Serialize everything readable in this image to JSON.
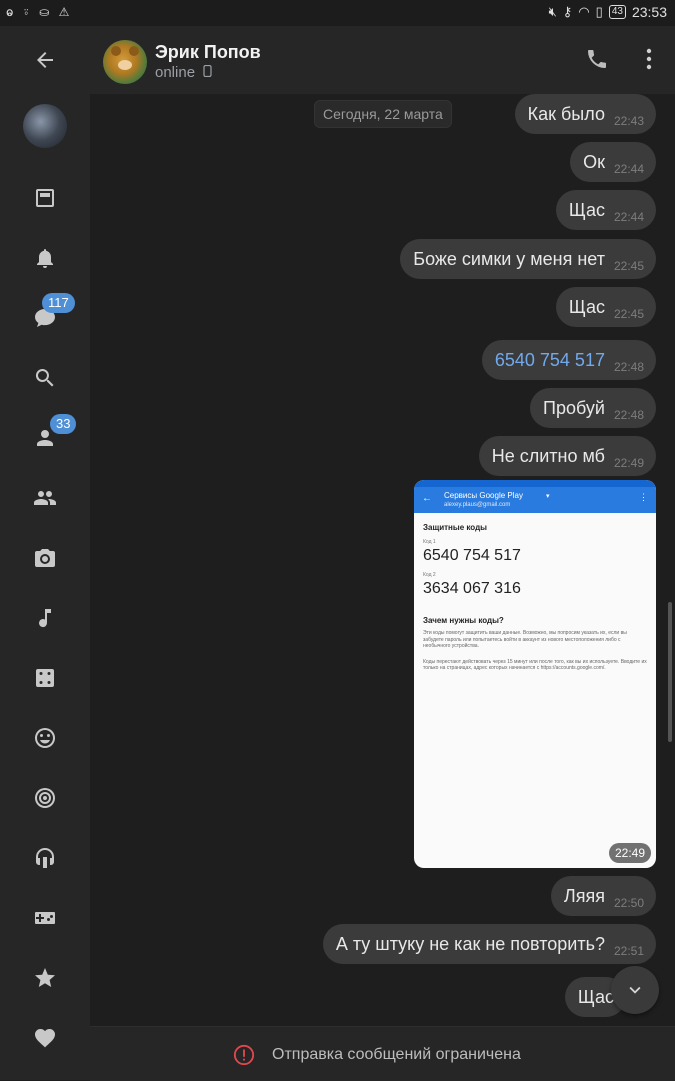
{
  "statusbar": {
    "left_icons": "ⱺ ⍤ ⛀ ⚠",
    "battery": "43",
    "time": "23:53"
  },
  "sidebar": {
    "badges": {
      "chats": "117",
      "contacts": "33"
    }
  },
  "header": {
    "name": "Эрик Попов",
    "status": "online"
  },
  "chat": {
    "date": "Сегодня, 22 марта",
    "messages": [
      {
        "text": "Как было",
        "time": "22:43"
      },
      {
        "text": "Ок",
        "time": "22:44"
      },
      {
        "text": "Щас",
        "time": "22:44"
      },
      {
        "text": "Боже симки у меня нет",
        "time": "22:45"
      },
      {
        "text": "Щас",
        "time": "22:45"
      },
      {
        "text": "6540 754 517",
        "time": "22:48"
      },
      {
        "text": "Пробуй",
        "time": "22:48"
      },
      {
        "text": "Не слитно мб",
        "time": "22:49"
      },
      {
        "text": "Ляяя",
        "time": "22:50"
      },
      {
        "text": "А ту штуку не как не повторить?",
        "time": "22:51"
      },
      {
        "text": "Щас",
        "time": ""
      }
    ],
    "photo": {
      "time": "22:49",
      "app_title": "Сервисы Google Play",
      "account": "alexey.plaus@gmail.com",
      "heading": "Защитные коды",
      "code1_label": "Код 1",
      "code1": "6540 754 517",
      "code2_label": "Код 2",
      "code2": "3634 067 316",
      "why_heading": "Зачем нужны коды?",
      "para1": "Эти коды помогут защитить ваши данные. Возможно, мы попросим указать их, если вы забудете пароль или попытаетесь войти в аккаунт из нового местоположения либо с необычного устройства.",
      "para2": "Коды перестают действовать через 15 минут или после того, как вы их используете. Вводите их только на страницах, адрес которых начинается с https://accounts.google.com/."
    }
  },
  "bottom": {
    "restricted": "Отправка сообщений ограничена"
  },
  "colors": {
    "accent": "#4e8fd6",
    "bubble": "#3b3b3b",
    "link": "#72a9ec"
  }
}
